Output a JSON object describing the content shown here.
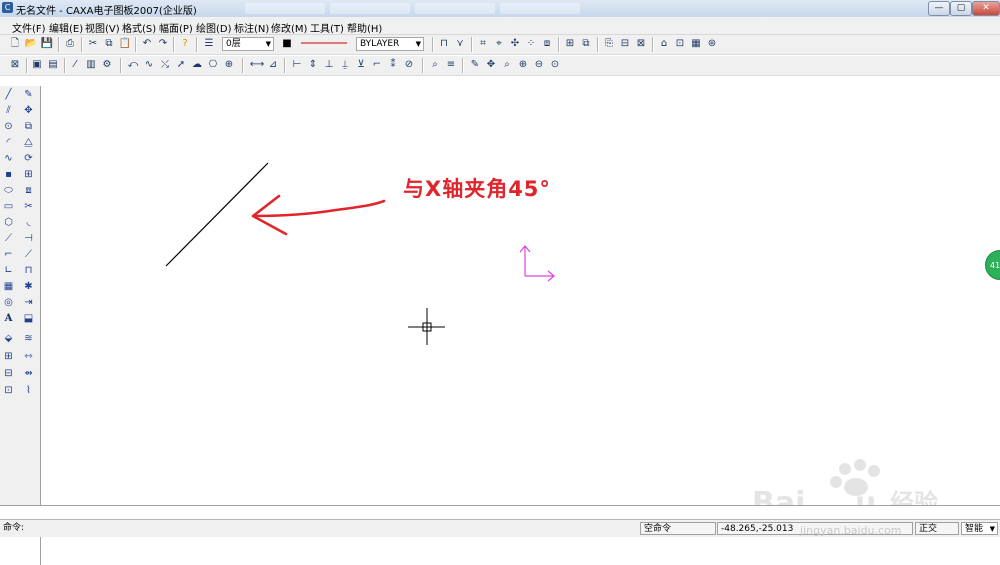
{
  "window": {
    "title": "无名文件 - CAXA电子图板2007(企业版)",
    "icon": "caxa-app-icon",
    "minimize_label": "—",
    "maximize_label": "▢",
    "close_label": "✕"
  },
  "menu": {
    "items": [
      {
        "label": "文件(F)"
      },
      {
        "label": "编辑(E)"
      },
      {
        "label": "视图(V)"
      },
      {
        "label": "格式(S)"
      },
      {
        "label": "幅面(P)"
      },
      {
        "label": "绘图(D)"
      },
      {
        "label": "标注(N)"
      },
      {
        "label": "修改(M)"
      },
      {
        "label": "工具(T)"
      },
      {
        "label": "帮助(H)"
      }
    ]
  },
  "toolbar": {
    "layer_value": "0层",
    "linetype_value": "BYLAYER",
    "color_swatch": "#000000",
    "line_color": "#cc0000"
  },
  "annotation": {
    "text": "与X轴夹角45°",
    "color": "#e0262c"
  },
  "colors": {
    "ucs_icon": "#e040e0",
    "drawn_line": "#000000"
  },
  "side_handle": {
    "label": "41"
  },
  "status": {
    "command_label": "命令:",
    "mode": "空命令",
    "coordinates": "-48.265,-25.013",
    "snap_mode": "正交",
    "smart_mode": "智能"
  },
  "watermark": {
    "text": "jingyan.baidu.com"
  }
}
